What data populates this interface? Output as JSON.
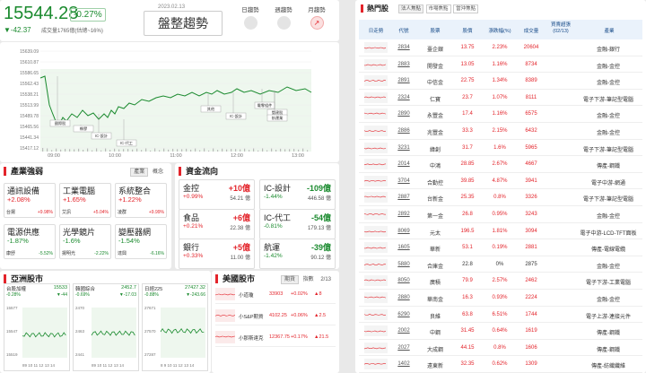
{
  "header": {
    "price": "15544.28",
    "pct": "-0.27%",
    "change": "▼-42.37",
    "volume": "成交量1765億(估總~16%)",
    "date": "2023.02.13",
    "trend": "盤整趨勢",
    "potentials": [
      {
        "label": "日趨勢",
        "active": false
      },
      {
        "label": "週趨勢",
        "active": false
      },
      {
        "label": "月趨勢",
        "active": true
      }
    ]
  },
  "main_chart": {
    "y_ticks": [
      "15639.09",
      "15610.87",
      "15586.65",
      "15562.43",
      "15538.21",
      "15513.99",
      "15489.78",
      "15465.56",
      "15441.34",
      "15417.12"
    ],
    "x_ticks": [
      "09:00",
      "10:00",
      "11:00",
      "12:00",
      "13:00"
    ],
    "annotations": [
      "國際股",
      "橡膠",
      "IC-設計",
      "IC-代工",
      "其他",
      "IC-設計",
      "電零組件",
      "營建股",
      "航運業"
    ]
  },
  "industry": {
    "title": "產業強弱",
    "tabs": [
      "產業",
      "概念"
    ],
    "cells": [
      {
        "name": "通訊設備",
        "pct": "+2.08%",
        "bl": "台揚",
        "br": "+9.98%",
        "dir": "up"
      },
      {
        "name": "工業電腦",
        "pct": "+1.65%",
        "bl": "艾訊",
        "br": "+5.04%",
        "dir": "up"
      },
      {
        "name": "系統整合",
        "pct": "+1.22%",
        "bl": "凌群",
        "br": "+9.99%",
        "dir": "up"
      },
      {
        "name": "電源供應",
        "pct": "-1.87%",
        "bl": "康舒",
        "br": "-5.52%",
        "dir": "down"
      },
      {
        "name": "光學鏡片",
        "pct": "-1.6%",
        "bl": "揚明光",
        "br": "-2.22%",
        "dir": "down"
      },
      {
        "name": "變壓器網",
        "pct": "-1.54%",
        "bl": "達興",
        "br": "-6.16%",
        "dir": "down"
      }
    ]
  },
  "fundflow": {
    "title": "資金流向",
    "cells": [
      {
        "name": "金控",
        "val": "+10億",
        "pct": "+0.99%",
        "tot": "54.21 億",
        "dir": "up"
      },
      {
        "name": "IC-設計",
        "val": "-109億",
        "pct": "-1.44%",
        "tot": "446.58 億",
        "dir": "down"
      },
      {
        "name": "食品",
        "val": "+6億",
        "pct": "+0.21%",
        "tot": "22.38 億",
        "dir": "up"
      },
      {
        "name": "IC-代工",
        "val": "-54億",
        "pct": "-0.81%",
        "tot": "179.13 億",
        "dir": "down"
      },
      {
        "name": "銀行",
        "val": "+5億",
        "pct": "+0.33%",
        "tot": "11.00 億",
        "dir": "up"
      },
      {
        "name": "航運",
        "val": "-39億",
        "pct": "-1.42%",
        "tot": "90.12 億",
        "dir": "down"
      }
    ]
  },
  "asia": {
    "title": "亞洲股市",
    "markets": [
      {
        "name": "台股加權",
        "price": "15533",
        "pct": "-0.28%",
        "chg": "▼-44",
        "dir": "down",
        "yt": [
          "15577",
          "15547",
          "15519"
        ],
        "xt": "89 10 11 12 13 14"
      },
      {
        "name": "韓國綜合",
        "price": "2452.7",
        "pct": "-0.69%",
        "chg": "▼-17.03",
        "dir": "down",
        "yt": [
          "2470",
          "2463",
          "2441"
        ],
        "xt": "89 10 11 12 13 14"
      },
      {
        "name": "日經225",
        "price": "27427.32",
        "pct": "-0.88%",
        "chg": "▼-243.66",
        "dir": "down",
        "yt": [
          "27671",
          "27570",
          "27287"
        ],
        "xt": "8 9 10 11 12 13 14"
      }
    ]
  },
  "us": {
    "title": "美國股市",
    "tabs": [
      "期貨",
      "指數"
    ],
    "time": "2/13",
    "rows": [
      {
        "name": "小道瓊",
        "price": "33903",
        "pct": "+0.02%",
        "chg": "▲8",
        "dir": "up"
      },
      {
        "name": "小S&P期貨",
        "price": "4102.25",
        "pct": "+0.06%",
        "chg": "▲2.5",
        "dir": "up"
      },
      {
        "name": "小那斯達克",
        "price": "12367.75",
        "pct": "+0.17%",
        "chg": "▲21.5",
        "dir": "up"
      }
    ]
  },
  "hot": {
    "title": "熱門股",
    "tabs": [
      "法人焦點",
      "市場焦點",
      "當沖焦點"
    ],
    "headers": [
      "日走勢",
      "代號",
      "股票",
      "股價",
      "漲跌幅(%)",
      "成交量",
      "買賣超張\n(02/13)",
      "產業"
    ],
    "rows": [
      {
        "code": "2834",
        "name": "臺企銀",
        "price": "13.75",
        "pct": "2.23%",
        "vol": "20604",
        "ind": "金融-銀行",
        "dir": "up"
      },
      {
        "code": "2883",
        "name": "開發金",
        "price": "13.05",
        "pct": "1.16%",
        "vol": "8734",
        "ind": "金融-金控",
        "dir": "up"
      },
      {
        "code": "2891",
        "name": "中信金",
        "price": "22.75",
        "pct": "1.34%",
        "vol": "8389",
        "ind": "金融-金控",
        "dir": "up"
      },
      {
        "code": "2324",
        "name": "仁寶",
        "price": "23.7",
        "pct": "1.07%",
        "vol": "8111",
        "ind": "電子下游-筆記型電腦",
        "dir": "up"
      },
      {
        "code": "2890",
        "name": "永豐金",
        "price": "17.4",
        "pct": "1.16%",
        "vol": "6575",
        "ind": "金融-金控",
        "dir": "up"
      },
      {
        "code": "2886",
        "name": "兆豐金",
        "price": "33.3",
        "pct": "2.15%",
        "vol": "6432",
        "ind": "金融-金控",
        "dir": "up"
      },
      {
        "code": "3231",
        "name": "緯創",
        "price": "31.7",
        "pct": "1.6%",
        "vol": "5965",
        "ind": "電子下游-筆記型電腦",
        "dir": "up"
      },
      {
        "code": "2014",
        "name": "中鴻",
        "price": "28.85",
        "pct": "2.67%",
        "vol": "4667",
        "ind": "傳產-鋼鐵",
        "dir": "up"
      },
      {
        "code": "3704",
        "name": "合勤控",
        "price": "39.85",
        "pct": "4.87%",
        "vol": "3941",
        "ind": "電子中游-網通",
        "dir": "up"
      },
      {
        "code": "2887",
        "name": "台新金",
        "price": "25.35",
        "pct": "0.8%",
        "vol": "3326",
        "ind": "電子下游-筆記型電腦",
        "dir": "up"
      },
      {
        "code": "2892",
        "name": "第一金",
        "price": "26.8",
        "pct": "0.95%",
        "vol": "3243",
        "ind": "金融-金控",
        "dir": "up"
      },
      {
        "code": "8069",
        "name": "元太",
        "price": "196.5",
        "pct": "1.81%",
        "vol": "3094",
        "ind": "電子中游-LCD-TFT面板",
        "dir": "up"
      },
      {
        "code": "1605",
        "name": "華新",
        "price": "53.1",
        "pct": "0.19%",
        "vol": "2881",
        "ind": "傳產-電線電纜",
        "dir": "up"
      },
      {
        "code": "5880",
        "name": "合庫金",
        "price": "22.8",
        "pct": "0%",
        "vol": "2875",
        "ind": "金融-金控",
        "dir": "flat"
      },
      {
        "code": "8050",
        "name": "廣積",
        "price": "79.9",
        "pct": "2.57%",
        "vol": "2462",
        "ind": "電子下游-工業電腦",
        "dir": "up"
      },
      {
        "code": "2880",
        "name": "華南金",
        "price": "16.3",
        "pct": "0.93%",
        "vol": "2224",
        "ind": "金融-金控",
        "dir": "up"
      },
      {
        "code": "6290",
        "name": "良維",
        "price": "63.8",
        "pct": "6.51%",
        "vol": "1744",
        "ind": "電子上游-連接元件",
        "dir": "up"
      },
      {
        "code": "2002",
        "name": "中鋼",
        "price": "31.45",
        "pct": "0.64%",
        "vol": "1619",
        "ind": "傳產-鋼鐵",
        "dir": "up"
      },
      {
        "code": "2027",
        "name": "大成鋼",
        "price": "44.15",
        "pct": "0.8%",
        "vol": "1606",
        "ind": "傳產-鋼鐵",
        "dir": "up"
      },
      {
        "code": "1402",
        "name": "遠東新",
        "price": "32.35",
        "pct": "0.62%",
        "vol": "1309",
        "ind": "傳產-紡織纖維",
        "dir": "up"
      }
    ]
  },
  "colors": {
    "up": "#e3242b",
    "down": "#1a8a2e",
    "accent": "#e3242b"
  }
}
